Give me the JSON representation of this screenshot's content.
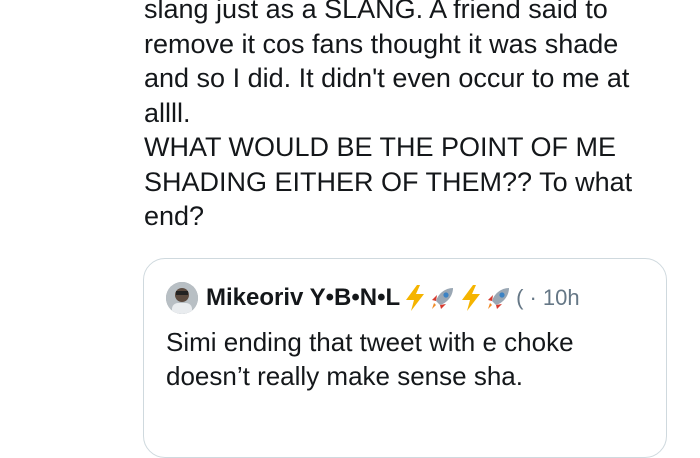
{
  "tweet": {
    "text": "slang just as a SLANG. A friend said to\nremove it cos fans thought it was shade\nand so I did. It didn't even occur to me at\nallll.\nWHAT WOULD BE THE POINT OF ME\nSHADING EITHER OF THEM?? To what\nend?"
  },
  "quoted_tweet": {
    "author_name": "Mikeoriv Y•B•N•L",
    "name_emojis": [
      "lightning-icon",
      "rocket-icon",
      "lightning-icon",
      "rocket-icon"
    ],
    "handle_fragment": "(",
    "time": "· 10h",
    "text": "Simi ending that tweet with e choke doesn’t really make sense sha."
  },
  "colors": {
    "text": "#14171a",
    "muted": "#657786",
    "border": "#cfd9de",
    "lightning": "#f5b400",
    "rocket_body": "#9aa7b4",
    "rocket_fin": "#d63a2f"
  }
}
